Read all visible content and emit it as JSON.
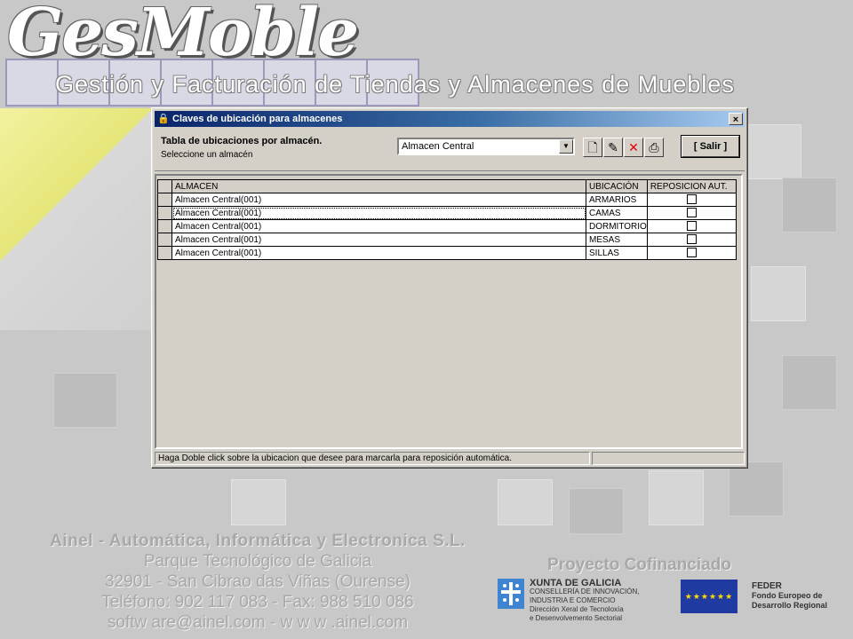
{
  "background": {
    "logo_text": "GesMoble",
    "subtitle": "Gestión y Facturación de Tiendas y Almacenes de Muebles",
    "company": {
      "name": "Ainel - Automática, Informática y Electronica S.L.",
      "line2": "Parque Tecnológico de Galicia",
      "line3": "32901 - San Cibrao das Viñas (Ourense)",
      "line4": "Teléfono: 902 117 083 - Fax: 988 510 086",
      "line5": "softw are@ainel.com - w w w .ainel.com"
    },
    "cofinanced": "Proyecto Cofinanciado",
    "xunta": {
      "title": "XUNTA DE GALICIA",
      "line1": "CONSELLERÍA DE INNOVACIÓN,",
      "line2": "INDUSTRIA E COMERCIO",
      "line3": "Dirección Xeral de Tecnoloxía",
      "line4": "e Desenvolvemento Sectorial"
    },
    "feder": {
      "title": "FEDER",
      "line1": "Fondo Europeo de",
      "line2": "Desarrollo Regional"
    }
  },
  "dialog": {
    "title": "Claves de ubicación para almacenes",
    "close_label": "×",
    "header_title": "Tabla de ubicaciones por almacén.",
    "header_sub": "Seleccione un almacén",
    "warehouse_select": {
      "value": "Almacen Central"
    },
    "toolbar": {
      "new_icon": "🗋",
      "edit_icon": "✎",
      "delete_icon": "✕",
      "print_icon": "⎙"
    },
    "salir_label": "[ Salir ]",
    "grid": {
      "columns": [
        "ALMACEN",
        "UBICACIÓN",
        "REPOSICION AUT."
      ],
      "rows": [
        {
          "almacen": "Almacen Central(001)",
          "ubicacion": "ARMARIOS",
          "reposicion": false
        },
        {
          "almacen": "Almacen Central(001)",
          "ubicacion": "CAMAS",
          "reposicion": false
        },
        {
          "almacen": "Almacen Central(001)",
          "ubicacion": "DORMITORIO",
          "reposicion": false
        },
        {
          "almacen": "Almacen Central(001)",
          "ubicacion": "MESAS",
          "reposicion": false
        },
        {
          "almacen": "Almacen Central(001)",
          "ubicacion": "SILLAS",
          "reposicion": false
        }
      ]
    },
    "status_text": "Haga Doble click sobre la ubicacion que desee para marcarla para reposición automática."
  },
  "colors": {
    "titlebar_start": "#0a246a",
    "titlebar_end": "#a6caf0",
    "window_face": "#d4d0c8",
    "delete_red": "#e00000"
  }
}
